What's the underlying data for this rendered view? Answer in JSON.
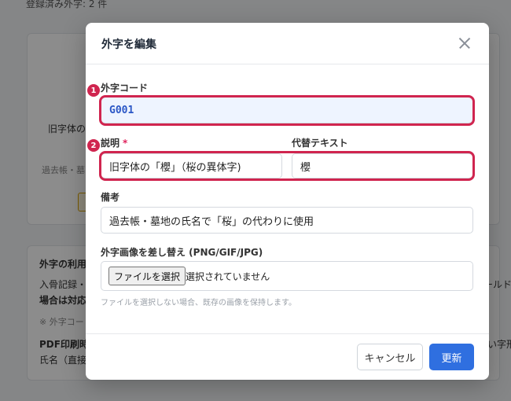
{
  "background": {
    "count_text": "登録済み外字: 2 件",
    "card1_line1": "旧字体の",
    "card1_line2": "過去帳・墓",
    "card2_title": "外字の利用",
    "card2_line1": "入骨記録・",
    "card2_line1_right": "ールド",
    "card2_line2": "場合は対応",
    "card2_note": "※ 外字コー",
    "card2_line3": "PDF印刷時",
    "card2_line3_right": "い字形",
    "card2_line4": "氏名（直接"
  },
  "modal": {
    "title": "外字を編集",
    "fields": {
      "code": {
        "label": "外字コード",
        "value": "G001",
        "badge": "1"
      },
      "description": {
        "label": "説明",
        "required_mark": "*",
        "value": "旧字体の「櫻」（桜の異体字)",
        "badge": "2"
      },
      "alt_text": {
        "label": "代替テキスト",
        "value": "櫻"
      },
      "notes": {
        "label": "備考",
        "value": "過去帳・墓地の氏名で「桜」の代わりに使用"
      },
      "image": {
        "label": "外字画像を差し替え (PNG/GIF/JPG)",
        "button_label": "ファイルを選択",
        "status": "選択されていません",
        "hint": "ファイルを選択しない場合、既存の画像を保持します。"
      }
    },
    "buttons": {
      "cancel": "キャンセル",
      "update": "更新"
    }
  },
  "colors": {
    "accent": "#2f6fe0",
    "highlight": "#d0254f",
    "required": "#e0245e"
  }
}
